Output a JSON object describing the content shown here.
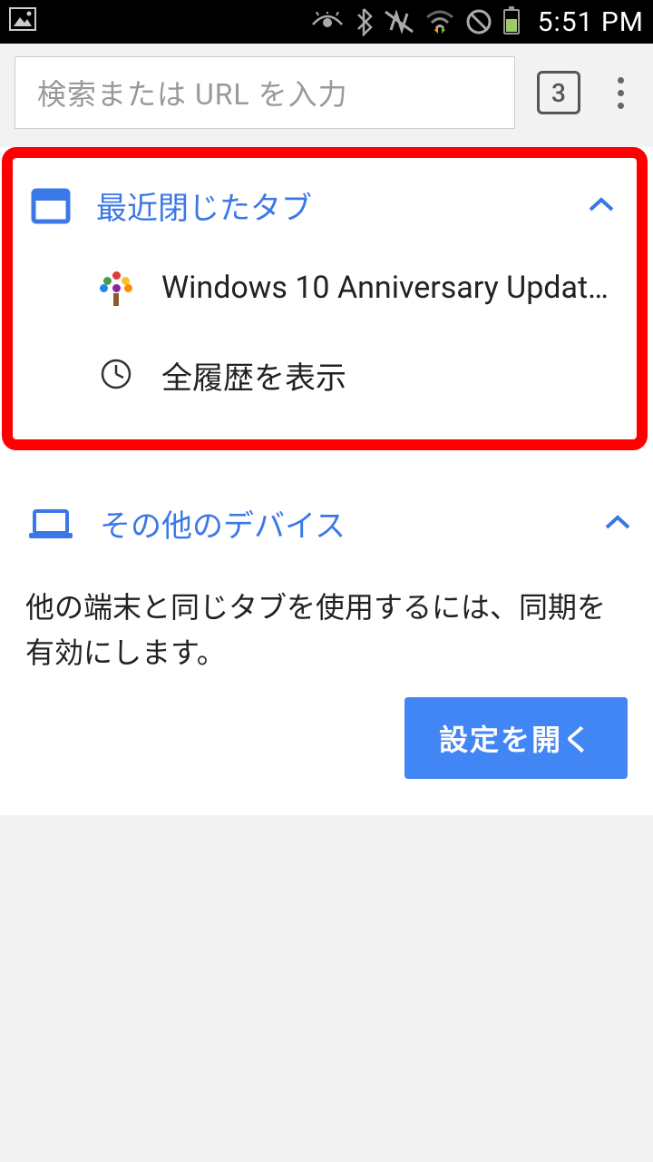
{
  "status": {
    "time": "5:51 PM"
  },
  "toolbar": {
    "omnibox_placeholder": "検索または URL を入力",
    "tab_count": "3"
  },
  "recent": {
    "title": "最近閉じたタブ",
    "items": [
      {
        "label": "Windows 10 Anniversary Update…"
      }
    ],
    "history_label": "全履歴を表示"
  },
  "devices": {
    "title": "その他のデバイス",
    "sync_message": "他の端末と同じタブを使用するには、同期を有効にします。",
    "open_settings_label": "設定を開く"
  }
}
